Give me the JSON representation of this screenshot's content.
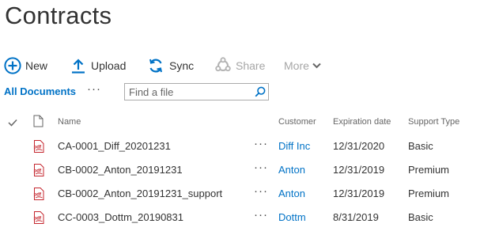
{
  "page": {
    "title": "Contracts"
  },
  "commands": {
    "new": {
      "label": "New",
      "icon": "plus-circle-icon"
    },
    "upload": {
      "label": "Upload",
      "icon": "upload-arrow-icon"
    },
    "sync": {
      "label": "Sync",
      "icon": "sync-icon"
    },
    "share": {
      "label": "Share",
      "icon": "share-icon",
      "disabled": true
    },
    "more": {
      "label": "More",
      "icon": "chevron-down-icon",
      "disabled": true
    }
  },
  "views": {
    "current": "All Documents",
    "more_label": "···"
  },
  "search": {
    "placeholder": "Find a file",
    "value": ""
  },
  "columns": {
    "name": "Name",
    "customer": "Customer",
    "expiration": "Expiration date",
    "support": "Support Type"
  },
  "rows": [
    {
      "name": "CA-0001_Diff_20201231",
      "ellipsis": "···",
      "customer": "Diff Inc",
      "expiration": "12/31/2020",
      "support": "Basic",
      "file_icon": "pdf-icon"
    },
    {
      "name": "CB-0002_Anton_20191231",
      "ellipsis": "···",
      "customer": "Anton",
      "expiration": "12/31/2019",
      "support": "Premium",
      "file_icon": "pdf-icon"
    },
    {
      "name": "CB-0002_Anton_20191231_support",
      "ellipsis": "···",
      "customer": "Anton",
      "expiration": "12/31/2019",
      "support": "Premium",
      "file_icon": "pdf-icon"
    },
    {
      "name": "CC-0003_Dottm_20190831",
      "ellipsis": "···",
      "customer": "Dottm",
      "expiration": "8/31/2019",
      "support": "Basic",
      "file_icon": "pdf-icon"
    }
  ],
  "colors": {
    "accent": "#0072c6",
    "text": "#333333",
    "disabled": "#a6a6a6",
    "pdf_red": "#c4262e"
  }
}
